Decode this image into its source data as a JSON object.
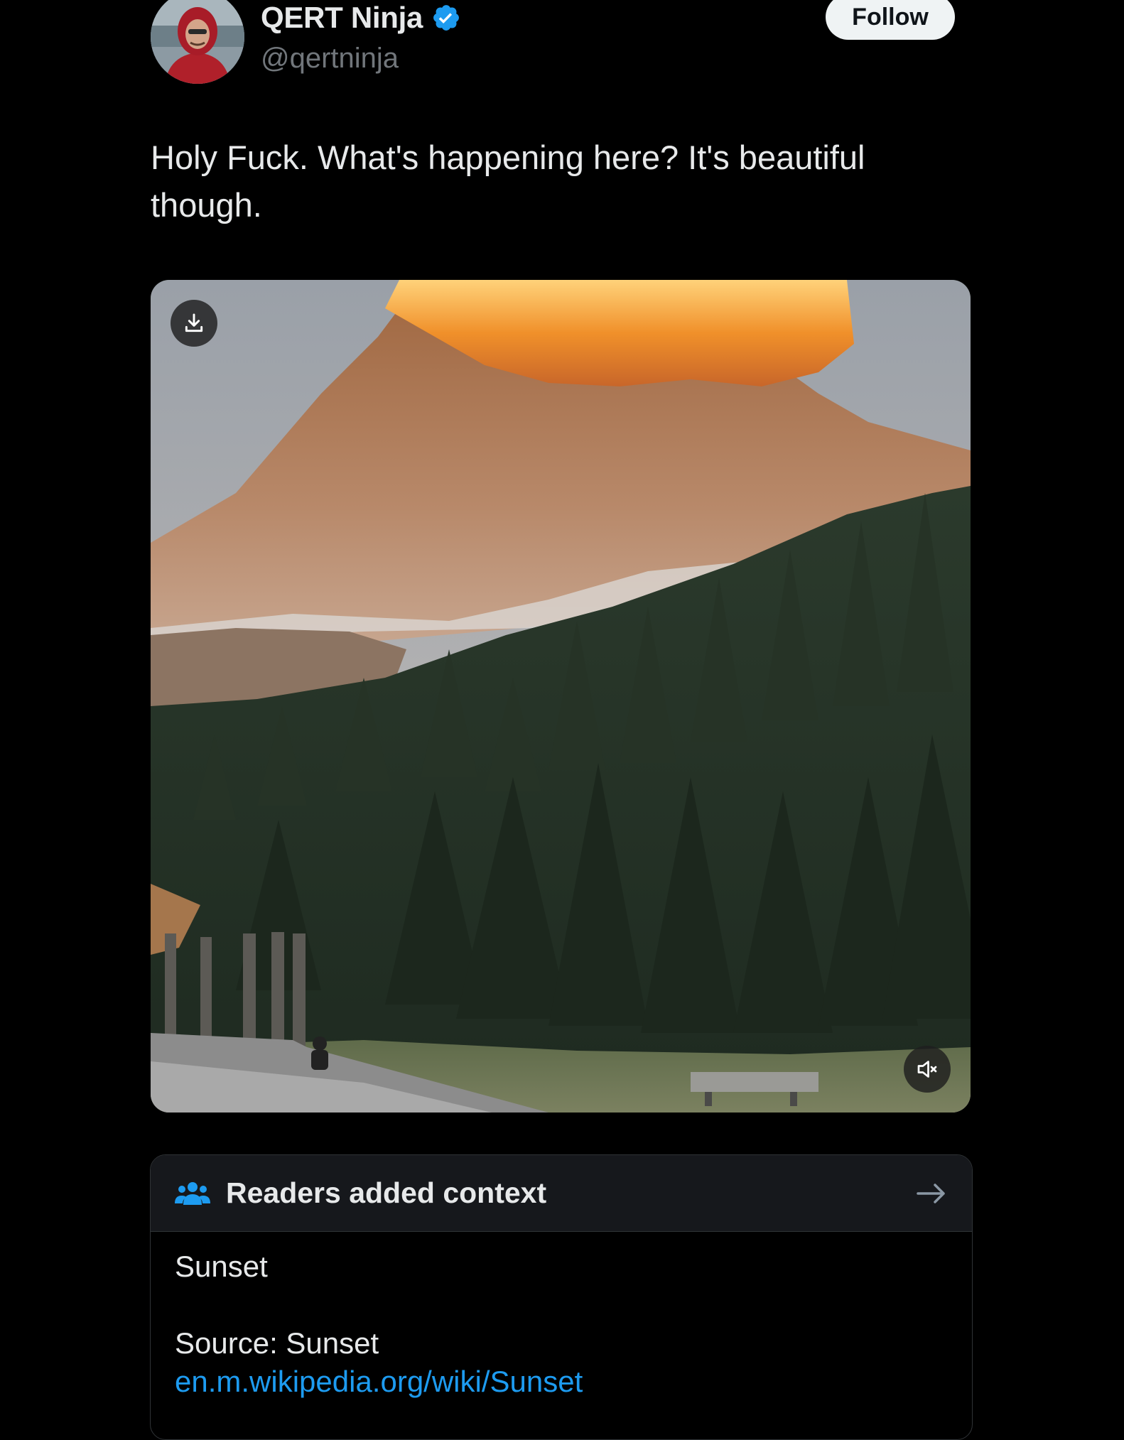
{
  "author": {
    "display_name": "QERT Ninja",
    "handle": "@qertninja",
    "verified_icon": "verified-badge-icon",
    "avatar_icon": "avatar-photo"
  },
  "follow_button": {
    "label": "Follow"
  },
  "tweet": {
    "text": "Holy Fuck. What's happening here? It's beautiful though."
  },
  "media": {
    "download_icon": "download-icon",
    "mute_icon": "speaker-muted-icon"
  },
  "note": {
    "title": "Readers added context",
    "header_icon": "people-icon",
    "arrow_icon": "arrow-right-icon",
    "body_text": "Sunset",
    "source_label": "Source: Sunset",
    "link_text": "en.m.wikipedia.org/wiki/Sunset"
  },
  "colors": {
    "background": "#000000",
    "text_primary": "#e7e9ea",
    "text_secondary": "#71767b",
    "accent_blue": "#1d9bf0",
    "note_header_bg": "#16181c",
    "follow_bg": "#eff3f4"
  }
}
